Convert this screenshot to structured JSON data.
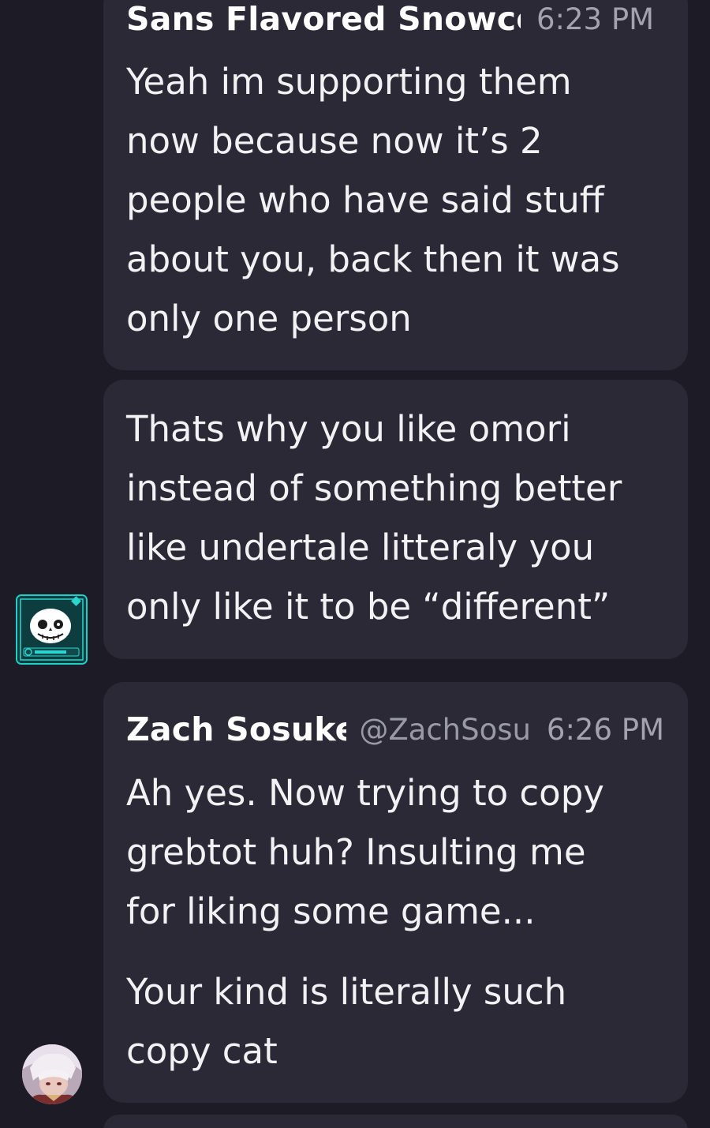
{
  "messages": [
    {
      "author": "Sans Flavored Snowcor",
      "time": "6:23 PM",
      "lines": [
        "Yeah im supporting them",
        "now because now it’s 2",
        "people who have said stuff",
        "about you, back then it was",
        "only one person"
      ]
    },
    {
      "lines": [
        "Thats why you like omori",
        "instead of something better",
        "like undertale litteraly you",
        "only like it to be “different”"
      ]
    },
    {
      "author": "Zach Sosuke",
      "handle": "@ZachSosul",
      "time": "6:26 PM",
      "lines": [
        "Ah yes. Now trying to copy",
        "grebtot huh? Insulting me",
        "for liking some game...",
        "Your kind is literally such",
        "copy cat"
      ]
    }
  ],
  "avatars": {
    "sans": "sans-skull-icon",
    "zach": "zach-profile-avatar"
  },
  "colors": {
    "background": "#1c1b26",
    "bubble": "#2a2935",
    "text": "#f2f2f5",
    "muted": "#a3a2ae",
    "accent": "#1fd0c8"
  }
}
